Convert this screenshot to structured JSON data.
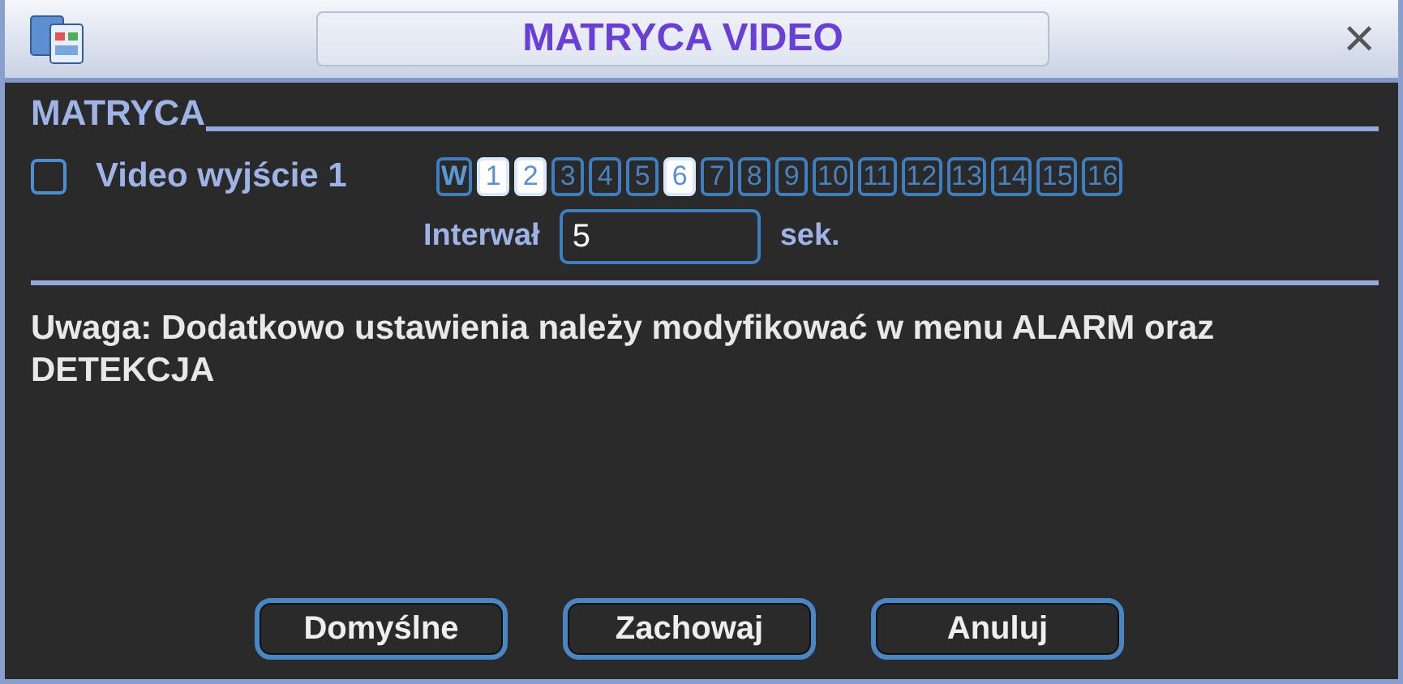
{
  "window": {
    "title": "MATRYCA VIDEO",
    "close": "×"
  },
  "section": {
    "title": "MATRYCA"
  },
  "output": {
    "label": "Video wyjście 1",
    "checked": false,
    "channels": [
      {
        "label": "W",
        "selected": false
      },
      {
        "label": "1",
        "selected": true
      },
      {
        "label": "2",
        "selected": true
      },
      {
        "label": "3",
        "selected": false
      },
      {
        "label": "4",
        "selected": false
      },
      {
        "label": "5",
        "selected": false
      },
      {
        "label": "6",
        "selected": true
      },
      {
        "label": "7",
        "selected": false
      },
      {
        "label": "8",
        "selected": false
      },
      {
        "label": "9",
        "selected": false
      },
      {
        "label": "10",
        "selected": false
      },
      {
        "label": "11",
        "selected": false
      },
      {
        "label": "12",
        "selected": false
      },
      {
        "label": "13",
        "selected": false
      },
      {
        "label": "14",
        "selected": false
      },
      {
        "label": "15",
        "selected": false
      },
      {
        "label": "16",
        "selected": false
      }
    ],
    "interval": {
      "label": "Interwał",
      "value": "5",
      "unit": "sek."
    }
  },
  "note": "Uwaga: Dodatkowo ustawienia należy modyfikować w menu ALARM oraz DETEKCJA",
  "buttons": [
    "Domyślne",
    "Zachowaj",
    "Anuluj"
  ]
}
